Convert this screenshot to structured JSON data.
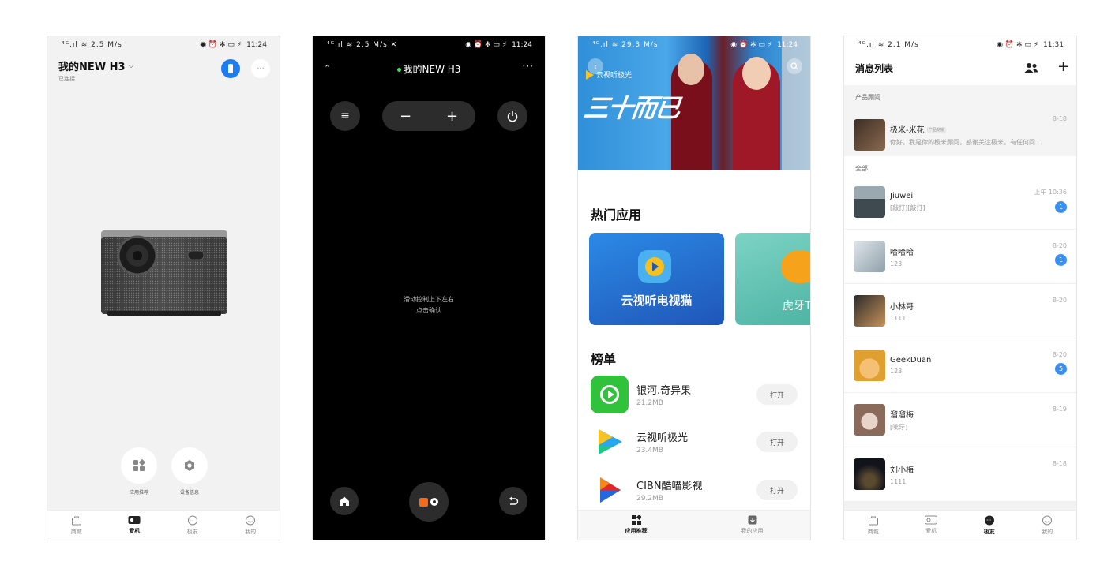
{
  "status": {
    "p1_time": "11:24",
    "p2_time": "11:24",
    "p3_time": "11:24",
    "p4_time": "11:31",
    "p1_signal": "⁴ᴳ.ıl ≋ 2.5 M/s",
    "p2_signal": "⁴ᴳ.ıl ≋ 2.5 M/s ✕",
    "p3_signal": "⁴ᴳ.ıl ≋ 29.3 M/s",
    "p4_signal": "⁴ᴳ.ıl ≋ 2.1 M/s",
    "icons_right": "◉ ⏰ ✻ ▭ ⚡"
  },
  "device": {
    "title": "我的NEW H3",
    "subtitle": "已连接",
    "actions": [
      {
        "label": "应用推荐",
        "icon": "apps-icon"
      },
      {
        "label": "设备信息",
        "icon": "hexagon-icon"
      }
    ]
  },
  "remote": {
    "title": "我的NEW H3",
    "hint_line1": "滑动控制上下左右",
    "hint_line2": "点击确认",
    "minus": "−",
    "plus": "+"
  },
  "store": {
    "banner_brand": "云视听极光",
    "banner_title": "三十而已",
    "hot_title": "热门应用",
    "hot_apps": [
      {
        "name": "云视听电视猫",
        "color": "#2a69c8"
      },
      {
        "name": "虎牙TV",
        "color": "#5cc0b0"
      }
    ],
    "rank_title": "榜单",
    "rank_apps": [
      {
        "name": "银河.奇异果",
        "size": "21.2MB",
        "btn": "打开"
      },
      {
        "name": "云视听极光",
        "size": "23.4MB",
        "btn": "打开"
      },
      {
        "name": "CIBN酷喵影视",
        "size": "29.2MB",
        "btn": "打开"
      }
    ],
    "tabs": [
      "应用推荐",
      "我的应用"
    ]
  },
  "messages": {
    "title": "消息列表",
    "section_advisor": "产品顾问",
    "advisor": {
      "name": "极米-米花",
      "tag": "产品专家",
      "preview": "你好，我是你的极米顾问，感谢关注极米。有任何问...",
      "time": "8-18"
    },
    "section_all": "全部",
    "items": [
      {
        "name": "Jiuwei",
        "preview": "[敲打][敲打]",
        "time": "上午 10:36",
        "badge": "1",
        "color": "#6c7a80"
      },
      {
        "name": "哈哈哈",
        "preview": "123",
        "time": "8-20",
        "badge": "1",
        "color": "#b8c4cc"
      },
      {
        "name": "小林哥",
        "preview": "1111",
        "time": "8-20",
        "badge": "",
        "color": "#8a6a4a"
      },
      {
        "name": "GeekDuan",
        "preview": "123",
        "time": "8-20",
        "badge": "5",
        "color": "#d9a640"
      },
      {
        "name": "溜溜梅",
        "preview": "[呲牙]",
        "time": "8-19",
        "badge": "",
        "color": "#b49080"
      },
      {
        "name": "刘小梅",
        "preview": "1111",
        "time": "8-18",
        "badge": "",
        "color": "#1a1e2a"
      }
    ]
  },
  "tabbar": {
    "main": [
      "商城",
      "爱机",
      "极友",
      "我的"
    ]
  }
}
